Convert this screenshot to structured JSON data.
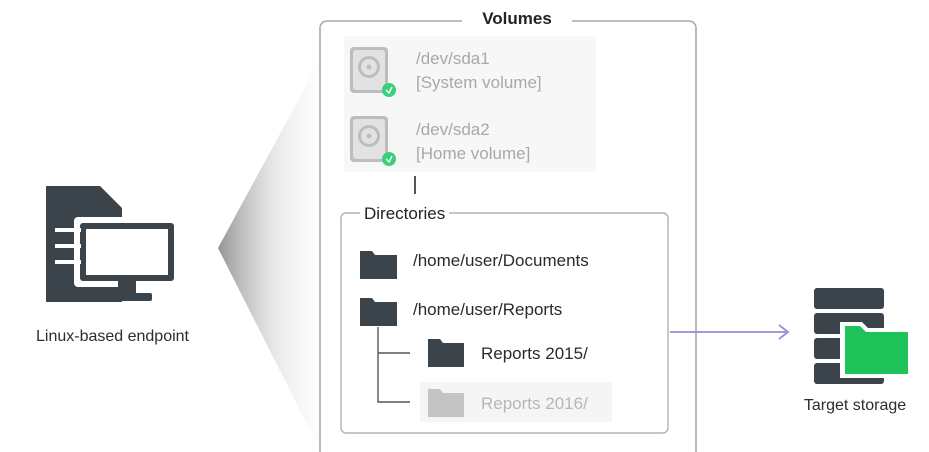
{
  "endpoint": {
    "label": "Linux-based endpoint",
    "icon": "linux-computer-icon"
  },
  "volumes": {
    "title": "Volumes",
    "items": [
      {
        "device": "/dev/sda1",
        "name": "[System volume]",
        "icon": "hard-drive-icon"
      },
      {
        "device": "/dev/sda2",
        "name": "[Home volume]",
        "icon": "hard-drive-icon"
      }
    ]
  },
  "directories": {
    "title": "Directories",
    "items": [
      {
        "path": "/home/user/Documents",
        "icon": "folder-icon"
      },
      {
        "path": "/home/user/Reports",
        "icon": "folder-icon"
      },
      {
        "path": "Reports 2015/",
        "icon": "folder-icon"
      },
      {
        "path": "Reports 2016/",
        "icon": "folder-icon",
        "state": "excluded"
      }
    ]
  },
  "target": {
    "label": "Target storage",
    "icon": "target-storage-icon"
  },
  "colors": {
    "dark_icon": "#3c444b",
    "accent_green": "#1ec45a",
    "arrow_purple": "#9d8ad8",
    "frame_gray": "#a9a9a9",
    "disabled_gray": "#c4c4c4"
  }
}
